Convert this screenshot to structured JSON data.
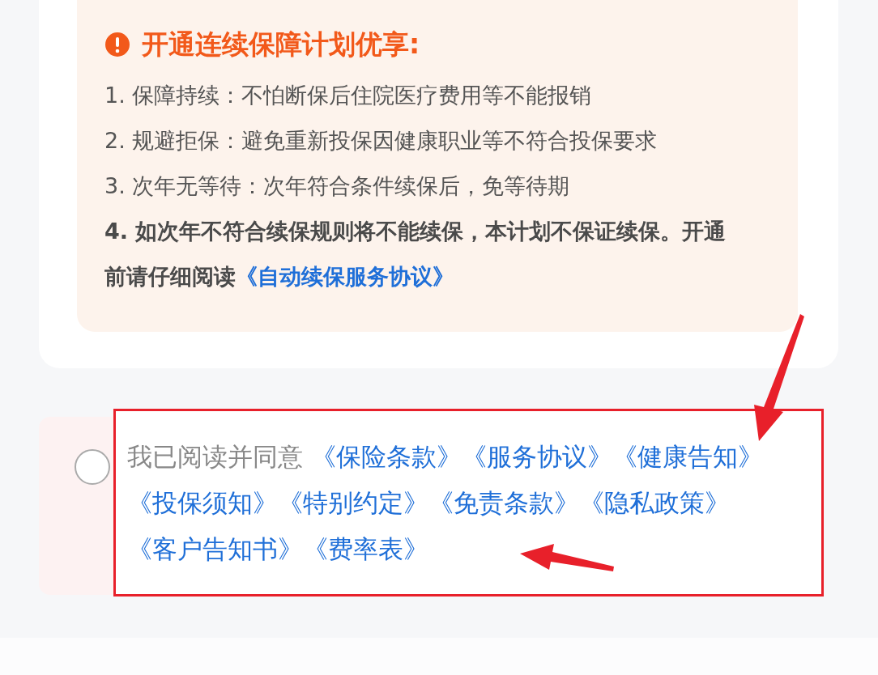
{
  "notice": {
    "title": "开通连续保障计划优享:",
    "items": [
      {
        "text": "1. 保障持续：不怕断保后住院医疗费用等不能报销",
        "bold": false
      },
      {
        "text": "2. 规避拒保：避免重新投保因健康职业等不符合投保要求",
        "bold": false
      },
      {
        "text": "3. 次年无等待：次年符合条件续保后，免等待期",
        "bold": false
      },
      {
        "text": "4. 如次年不符合续保规则将不能续保，本计划不保证续保。开通前请仔细阅读",
        "bold": true,
        "link": "《自动续保服务协议》"
      }
    ]
  },
  "agreement": {
    "checked": false,
    "prefix": "我已阅读并同意 ",
    "links": [
      "《保险条款》",
      "《服务协议》",
      "《健康告知》",
      "《投保须知》",
      "《特别约定》",
      "《免责条款》",
      "《隐私政策》",
      "《客户告知书》",
      "《费率表》"
    ]
  }
}
